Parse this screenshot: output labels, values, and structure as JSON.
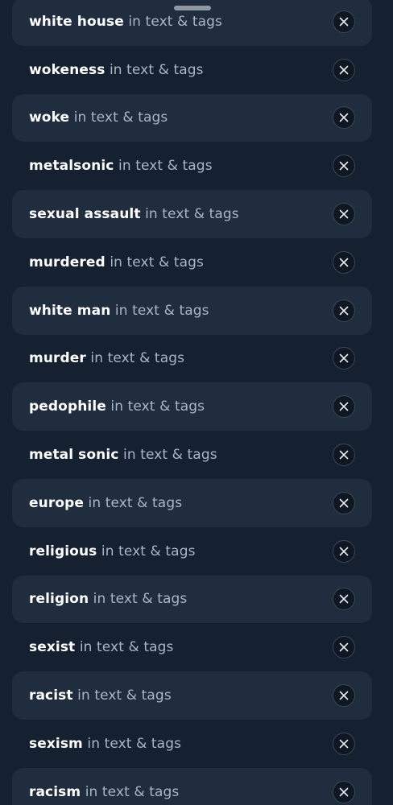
{
  "muted_words": {
    "suffix": "in text & tags",
    "items": [
      {
        "term": "white house"
      },
      {
        "term": "wokeness"
      },
      {
        "term": "woke"
      },
      {
        "term": "metalsonic"
      },
      {
        "term": "sexual assault"
      },
      {
        "term": "murdered"
      },
      {
        "term": "white man"
      },
      {
        "term": "murder"
      },
      {
        "term": "pedophile"
      },
      {
        "term": "metal sonic"
      },
      {
        "term": "europe"
      },
      {
        "term": "religious"
      },
      {
        "term": "religion"
      },
      {
        "term": "sexist"
      },
      {
        "term": "racist"
      },
      {
        "term": "sexism"
      },
      {
        "term": "racism"
      }
    ]
  },
  "icons": {
    "remove": "close-icon",
    "sheet": "drag-handle"
  },
  "colors": {
    "background": "#152130",
    "row_shaded": "#1f2d3e",
    "term_text": "#ffffff",
    "suffix_text": "#a8b6c6"
  }
}
